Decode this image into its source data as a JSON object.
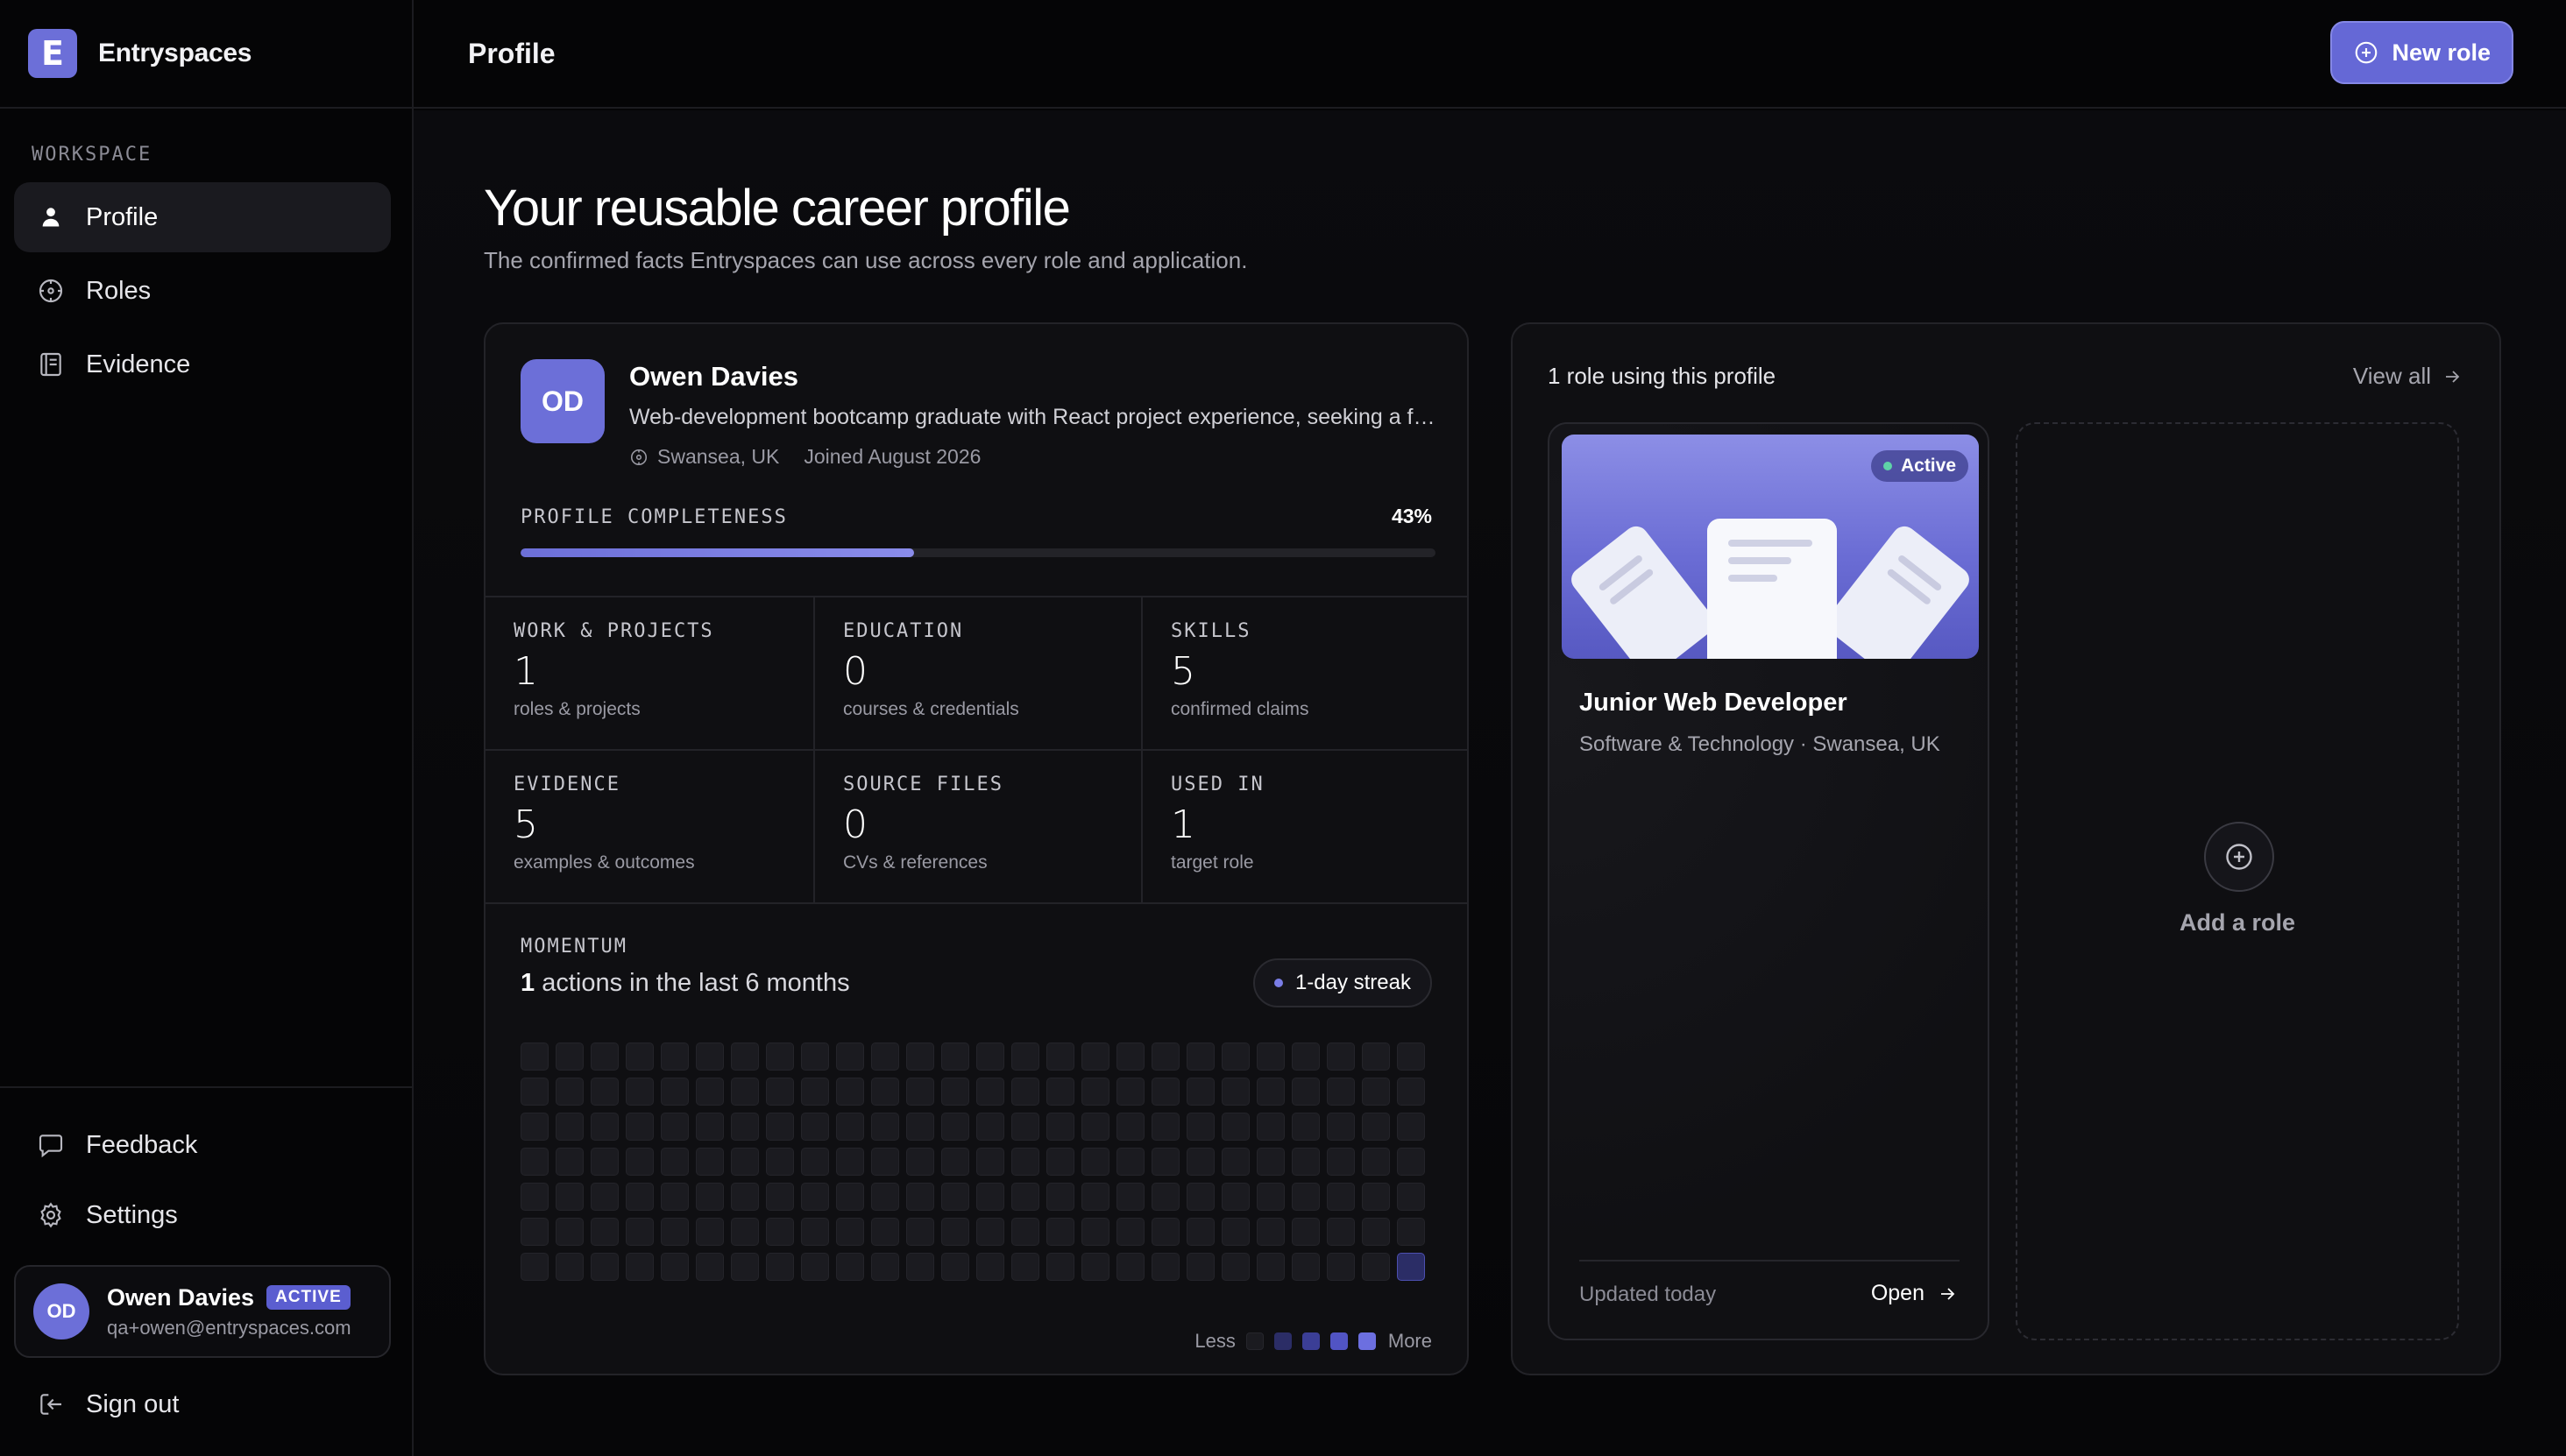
{
  "brand": {
    "logo_letter": "E",
    "name": "Entryspaces",
    "accent": "#6c6fd8"
  },
  "sidebar": {
    "section_label": "WORKSPACE",
    "items": [
      {
        "label": "Profile",
        "icon": "user-icon",
        "active": true
      },
      {
        "label": "Roles",
        "icon": "compass-icon",
        "active": false
      },
      {
        "label": "Evidence",
        "icon": "notebook-icon",
        "active": false
      }
    ],
    "bottom": {
      "feedback": "Feedback",
      "settings": "Settings",
      "signout": "Sign out"
    },
    "user": {
      "initials": "OD",
      "name": "Owen Davies",
      "badge": "ACTIVE",
      "email": "qa+owen@entryspaces.com"
    }
  },
  "header": {
    "title": "Profile",
    "new_role_label": "New role"
  },
  "hero": {
    "title": "Your reusable career profile",
    "subtitle": "The confirmed facts Entryspaces can use across every role and application."
  },
  "profile": {
    "initials": "OD",
    "name": "Owen Davies",
    "bio": "Web-development bootcamp graduate with React project experience, seeking a first role in front-end development.",
    "location": "Swansea, UK",
    "joined": "Joined August 2026",
    "completeness_label": "PROFILE COMPLETENESS",
    "completeness_value": "43%",
    "completeness_fraction": 0.43
  },
  "stats": [
    {
      "label": "WORK & PROJECTS",
      "value": "1",
      "sub": "roles & projects"
    },
    {
      "label": "EDUCATION",
      "value": "0",
      "sub": "courses & credentials"
    },
    {
      "label": "SKILLS",
      "value": "5",
      "sub": "confirmed claims"
    },
    {
      "label": "EVIDENCE",
      "value": "5",
      "sub": "examples & outcomes"
    },
    {
      "label": "SOURCE FILES",
      "value": "0",
      "sub": "CVs & references"
    },
    {
      "label": "USED IN",
      "value": "1",
      "sub": "target role"
    }
  ],
  "momentum": {
    "label": "MOMENTUM",
    "count": "1",
    "text": " actions in the last 6 months",
    "streak": "1-day streak",
    "grid_rows": 7,
    "grid_cols": 26,
    "active_cells": [
      [
        6,
        25
      ]
    ],
    "legend_less": "Less",
    "legend_more": "More",
    "legend_colors": [
      "#1b1b20",
      "#2b2d66",
      "#3b3e96",
      "#5154c4",
      "#6c6fe0"
    ]
  },
  "roles": {
    "count_text": "1 role using this profile",
    "view_all": "View all",
    "items": [
      {
        "status": "Active",
        "title": "Junior Web Developer",
        "subtitle": "Software & Technology · Swansea, UK",
        "updated": "Updated today",
        "open": "Open"
      }
    ],
    "add_label": "Add a role"
  }
}
